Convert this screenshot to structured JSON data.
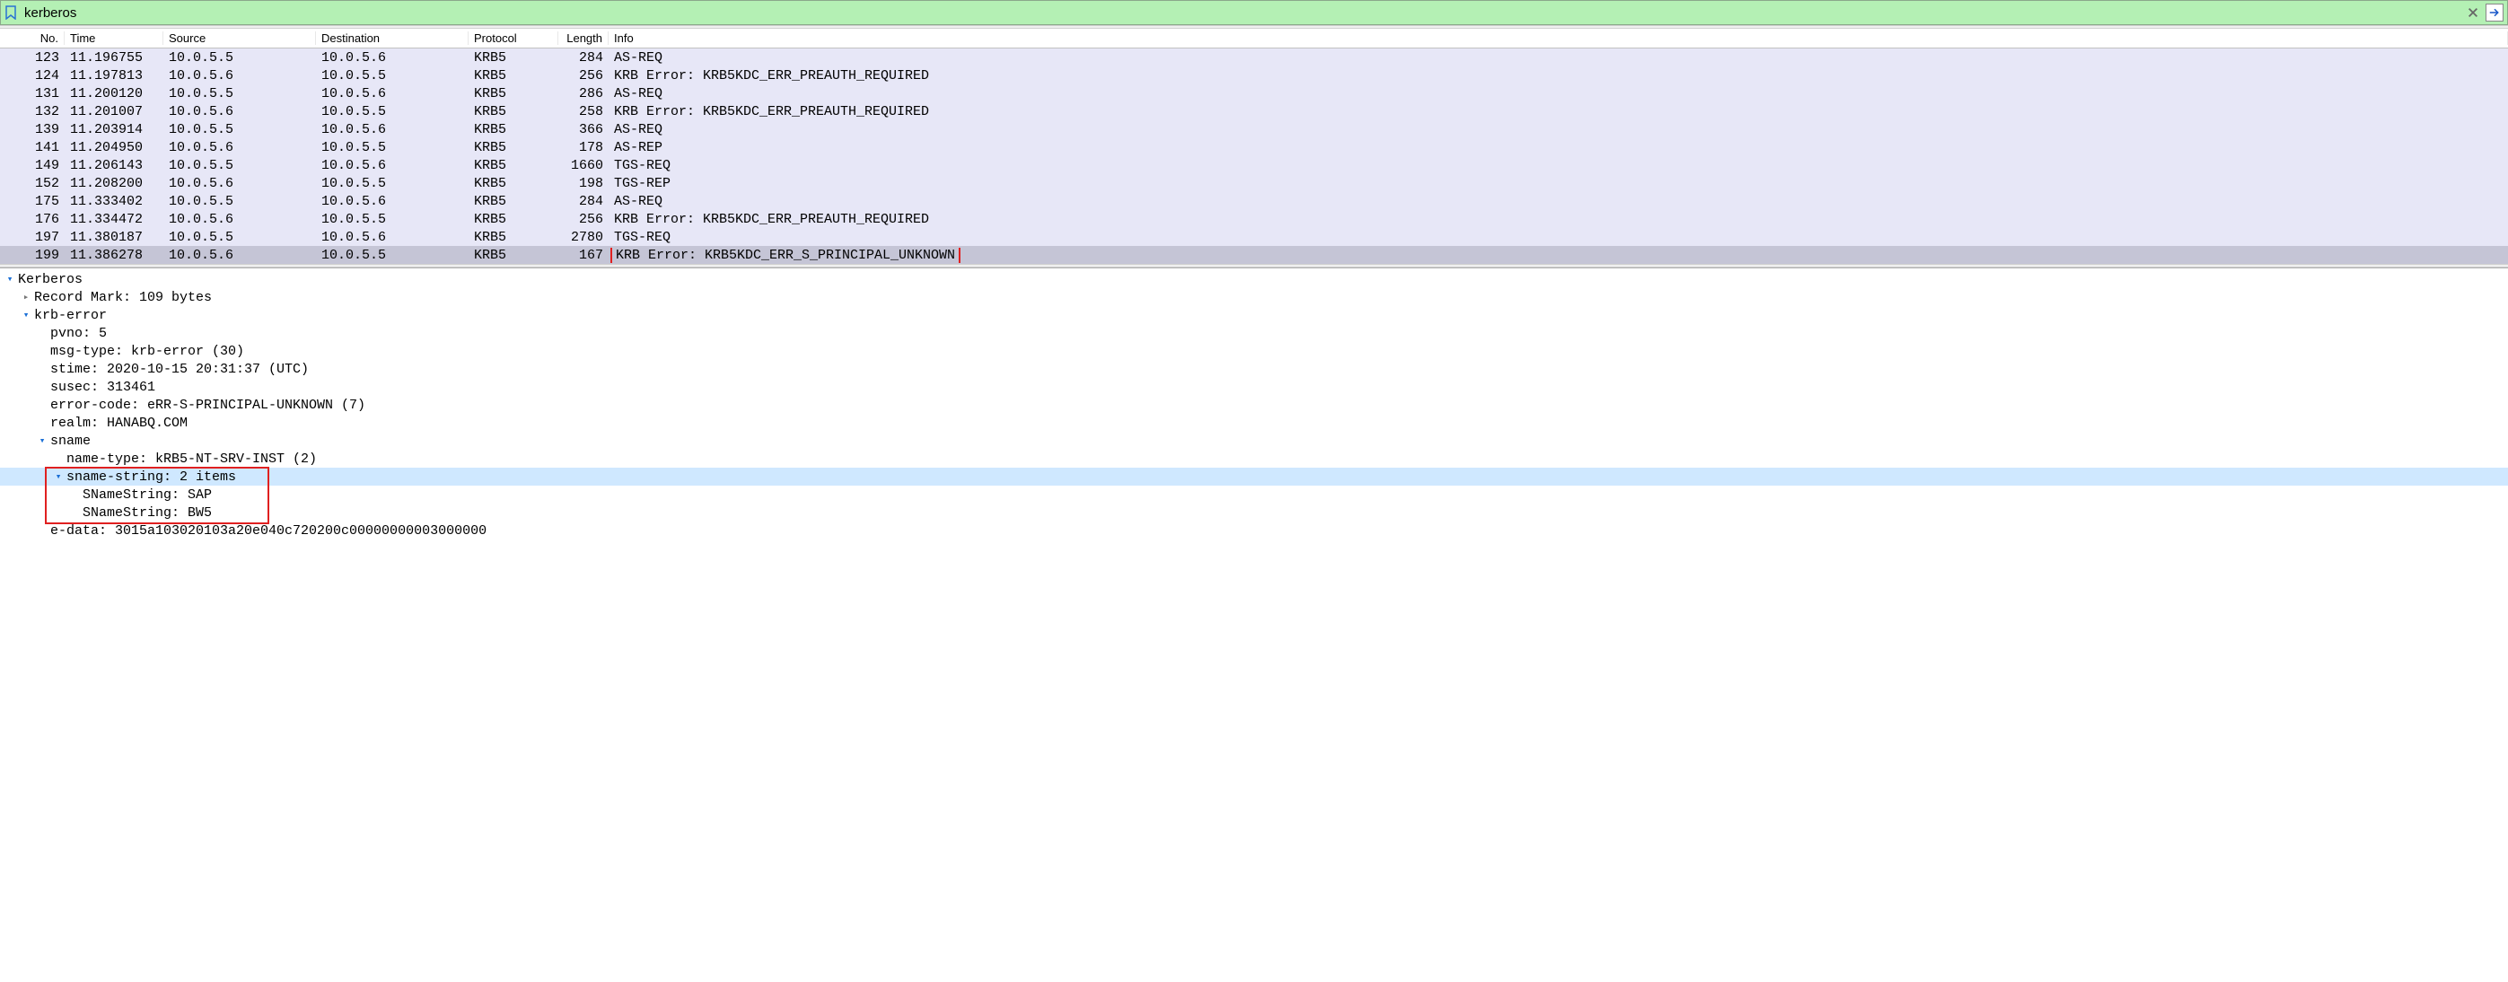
{
  "filter": {
    "value": "kerberos"
  },
  "columns": {
    "no": "No.",
    "time": "Time",
    "source": "Source",
    "destination": "Destination",
    "protocol": "Protocol",
    "length": "Length",
    "info": "Info"
  },
  "packets": [
    {
      "no": "123",
      "time": "11.196755",
      "src": "10.0.5.5",
      "dst": "10.0.5.6",
      "proto": "KRB5",
      "len": "284",
      "info": "AS-REQ"
    },
    {
      "no": "124",
      "time": "11.197813",
      "src": "10.0.5.6",
      "dst": "10.0.5.5",
      "proto": "KRB5",
      "len": "256",
      "info": "KRB Error: KRB5KDC_ERR_PREAUTH_REQUIRED"
    },
    {
      "no": "131",
      "time": "11.200120",
      "src": "10.0.5.5",
      "dst": "10.0.5.6",
      "proto": "KRB5",
      "len": "286",
      "info": "AS-REQ"
    },
    {
      "no": "132",
      "time": "11.201007",
      "src": "10.0.5.6",
      "dst": "10.0.5.5",
      "proto": "KRB5",
      "len": "258",
      "info": "KRB Error: KRB5KDC_ERR_PREAUTH_REQUIRED"
    },
    {
      "no": "139",
      "time": "11.203914",
      "src": "10.0.5.5",
      "dst": "10.0.5.6",
      "proto": "KRB5",
      "len": "366",
      "info": "AS-REQ"
    },
    {
      "no": "141",
      "time": "11.204950",
      "src": "10.0.5.6",
      "dst": "10.0.5.5",
      "proto": "KRB5",
      "len": "178",
      "info": "AS-REP"
    },
    {
      "no": "149",
      "time": "11.206143",
      "src": "10.0.5.5",
      "dst": "10.0.5.6",
      "proto": "KRB5",
      "len": "1660",
      "info": "TGS-REQ"
    },
    {
      "no": "152",
      "time": "11.208200",
      "src": "10.0.5.6",
      "dst": "10.0.5.5",
      "proto": "KRB5",
      "len": "198",
      "info": "TGS-REP"
    },
    {
      "no": "175",
      "time": "11.333402",
      "src": "10.0.5.5",
      "dst": "10.0.5.6",
      "proto": "KRB5",
      "len": "284",
      "info": "AS-REQ"
    },
    {
      "no": "176",
      "time": "11.334472",
      "src": "10.0.5.6",
      "dst": "10.0.5.5",
      "proto": "KRB5",
      "len": "256",
      "info": "KRB Error: KRB5KDC_ERR_PREAUTH_REQUIRED"
    },
    {
      "no": "197",
      "time": "11.380187",
      "src": "10.0.5.5",
      "dst": "10.0.5.6",
      "proto": "KRB5",
      "len": "2780",
      "info": "TGS-REQ"
    },
    {
      "no": "199",
      "time": "11.386278",
      "src": "10.0.5.6",
      "dst": "10.0.5.5",
      "proto": "KRB5",
      "len": "167",
      "info": "KRB Error: KRB5KDC_ERR_S_PRINCIPAL_UNKNOWN",
      "selected": true,
      "redbox": true
    }
  ],
  "details": {
    "root": "Kerberos",
    "record_mark": "Record Mark: 109 bytes",
    "krb_error_label": "krb-error",
    "pvno": "pvno: 5",
    "msg_type": "msg-type: krb-error (30)",
    "stime": "stime: 2020-10-15 20:31:37 (UTC)",
    "susec": "susec: 313461",
    "error_code": "error-code: eRR-S-PRINCIPAL-UNKNOWN (7)",
    "realm": "realm: HANABQ.COM",
    "sname_label": "sname",
    "name_type": "name-type: kRB5-NT-SRV-INST (2)",
    "sname_string_label": "sname-string: 2 items",
    "sname_string_1": "SNameString: SAP",
    "sname_string_2": "SNameString: BW5",
    "edata": "e-data: 3015a103020103a20e040c720200c00000000003000000"
  }
}
